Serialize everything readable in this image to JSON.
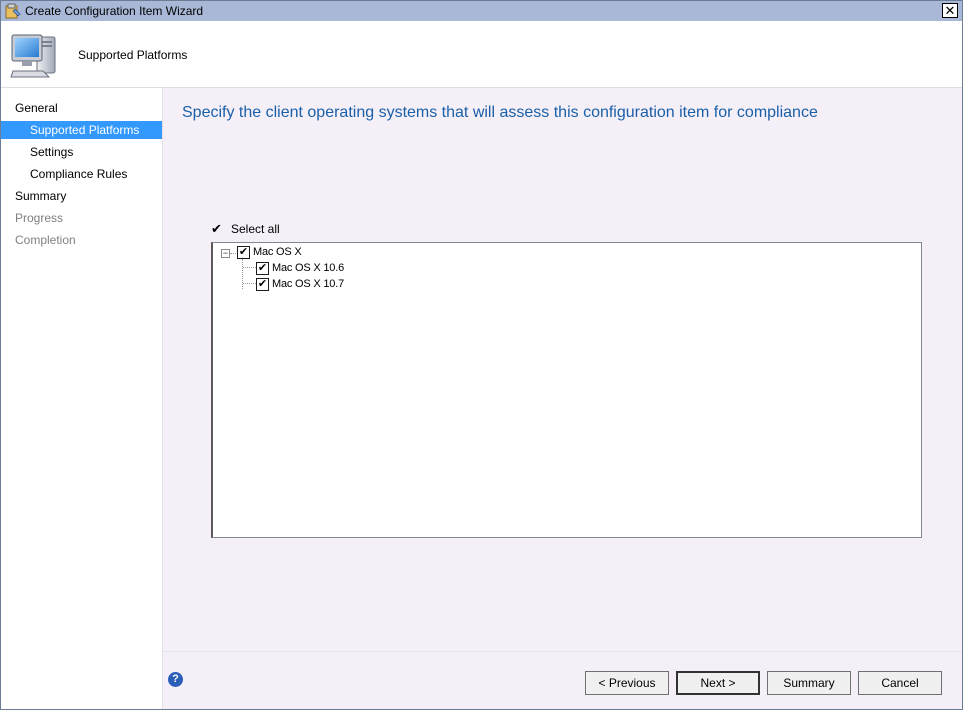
{
  "window": {
    "title": "Create Configuration Item Wizard",
    "close_glyph": "✕"
  },
  "header": {
    "title": "Supported Platforms",
    "icon": "computer-icon"
  },
  "sidebar": {
    "items": [
      {
        "label": "General",
        "state": "normal",
        "level": 0
      },
      {
        "label": "Supported Platforms",
        "state": "active",
        "level": 1
      },
      {
        "label": "Settings",
        "state": "normal",
        "level": 1
      },
      {
        "label": "Compliance Rules",
        "state": "normal",
        "level": 1
      },
      {
        "label": "Summary",
        "state": "normal",
        "level": 0
      },
      {
        "label": "Progress",
        "state": "disabled",
        "level": 0
      },
      {
        "label": "Completion",
        "state": "disabled",
        "level": 0
      }
    ]
  },
  "main": {
    "heading": "Specify the client operating systems that will assess this configuration item for compliance",
    "select_all": {
      "label": "Select all",
      "checked": true
    },
    "tree": {
      "root": {
        "label": "Mac OS X",
        "checked": true,
        "expanded": true
      },
      "children": [
        {
          "label": "Mac OS X 10.6",
          "checked": true
        },
        {
          "label": "Mac OS X 10.7",
          "checked": true
        }
      ]
    }
  },
  "footer": {
    "help_glyph": "?",
    "buttons": {
      "previous": "< Previous",
      "next": "Next >",
      "summary": "Summary",
      "cancel": "Cancel"
    }
  },
  "colors": {
    "accent": "#3399ff",
    "heading": "#1a5fa8",
    "titlebar": "#a8b8d6",
    "background": "#f5f0f8"
  },
  "glyphs": {
    "check": "✔",
    "collapse": "−"
  }
}
